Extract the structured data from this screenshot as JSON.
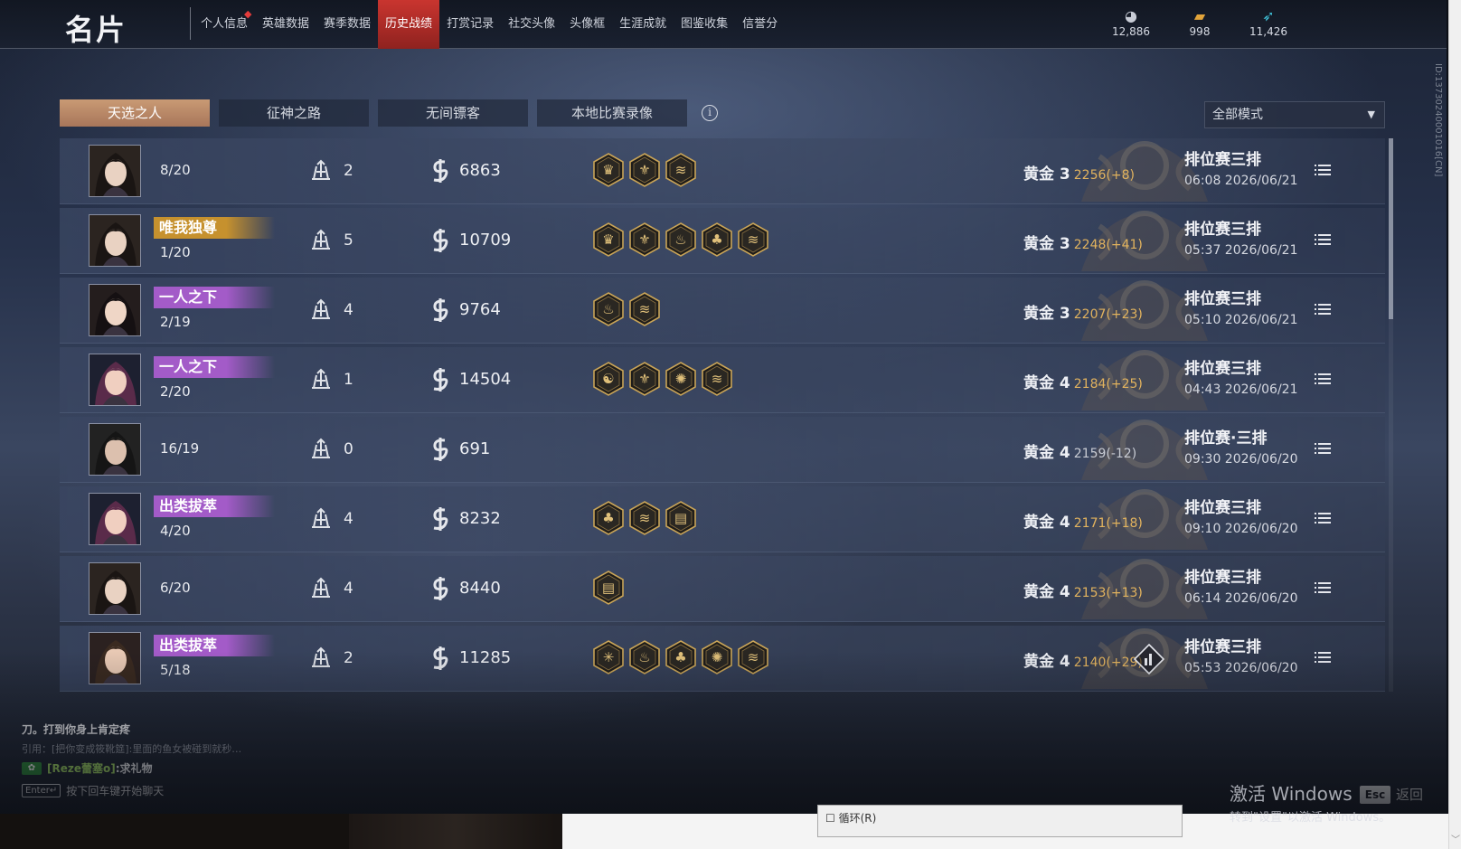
{
  "header": {
    "title": "名片",
    "tabs": [
      {
        "label": "个人信息",
        "active": false,
        "badge": true
      },
      {
        "label": "英雄数据",
        "active": false
      },
      {
        "label": "赛季数据",
        "active": false
      },
      {
        "label": "历史战绩",
        "active": true
      },
      {
        "label": "打赏记录",
        "active": false
      },
      {
        "label": "社交头像",
        "active": false
      },
      {
        "label": "头像框",
        "active": false
      },
      {
        "label": "生涯成就",
        "active": false
      },
      {
        "label": "图鉴收集",
        "active": false
      },
      {
        "label": "信誉分",
        "active": false
      }
    ],
    "currencies": [
      {
        "icon": "coin-stack-icon",
        "value": "12,886"
      },
      {
        "icon": "gold-bar-icon",
        "value": "998"
      },
      {
        "icon": "feather-icon",
        "value": "11,426"
      }
    ],
    "vertical_id": "ID:13730240001016[CN]"
  },
  "modes": {
    "tabs": [
      {
        "label": "天选之人",
        "active": true
      },
      {
        "label": "征神之路",
        "active": false
      },
      {
        "label": "无间镖客",
        "active": false
      },
      {
        "label": "本地比赛录像",
        "active": false
      }
    ],
    "info_icon": "info-icon",
    "filter_label": "全部模式"
  },
  "matches": [
    {
      "avatar": "hero-1",
      "title": "",
      "title_color": "",
      "placement": "8/20",
      "kills": "2",
      "damage": "6863",
      "medals": [
        "crown-medal",
        "helm-medal",
        "wing-medal"
      ],
      "rank": "黄金 3",
      "points": "2256(+8)",
      "trend": "up",
      "queue": "排位赛三排",
      "time": "06:08  2026/06/21",
      "stats_button": false
    },
    {
      "avatar": "hero-1",
      "title": "唯我独尊",
      "title_color": "#c6912e",
      "placement": "1/20",
      "kills": "5",
      "damage": "10709",
      "medals": [
        "crown-medal",
        "helm-medal",
        "flame-medal",
        "trio-medal",
        "wing-medal"
      ],
      "rank": "黄金 3",
      "points": "2248(+41)",
      "trend": "up",
      "queue": "排位赛三排",
      "time": "05:37  2026/06/21",
      "stats_button": false
    },
    {
      "avatar": "hero-2",
      "title": "一人之下",
      "title_color": "#a35bc8",
      "placement": "2/19",
      "kills": "4",
      "damage": "9764",
      "medals": [
        "flame-medal",
        "wing-medal"
      ],
      "rank": "黄金 3",
      "points": "2207(+23)",
      "trend": "up",
      "queue": "排位赛三排",
      "time": "05:10  2026/06/21",
      "stats_button": false
    },
    {
      "avatar": "hero-3",
      "title": "一人之下",
      "title_color": "#a35bc8",
      "placement": "2/20",
      "kills": "1",
      "damage": "14504",
      "medals": [
        "swirl-medal",
        "helm-medal",
        "sun-medal",
        "wing-medal"
      ],
      "rank": "黄金 4",
      "points": "2184(+25)",
      "trend": "up",
      "queue": "排位赛三排",
      "time": "04:43  2026/06/21",
      "stats_button": false
    },
    {
      "avatar": "hero-4",
      "title": "",
      "title_color": "",
      "placement": "16/19",
      "kills": "0",
      "damage": "691",
      "medals": [],
      "rank": "黄金 4",
      "points": "2159(-12)",
      "trend": "down",
      "queue": "排位赛·三排",
      "time": "09:30  2026/06/20",
      "stats_button": false
    },
    {
      "avatar": "hero-3",
      "title": "出类拔萃",
      "title_color": "#a35bc8",
      "placement": "4/20",
      "kills": "4",
      "damage": "8232",
      "medals": [
        "trio-medal",
        "wing-medal",
        "scroll-medal"
      ],
      "rank": "黄金 4",
      "points": "2171(+18)",
      "trend": "up",
      "queue": "排位赛三排",
      "time": "09:10  2026/06/20",
      "stats_button": false
    },
    {
      "avatar": "hero-1",
      "title": "",
      "title_color": "",
      "placement": "6/20",
      "kills": "4",
      "damage": "8440",
      "medals": [
        "scroll-medal"
      ],
      "rank": "黄金 4",
      "points": "2153(+13)",
      "trend": "up",
      "queue": "排位赛三排",
      "time": "06:14  2026/06/20",
      "stats_button": false
    },
    {
      "avatar": "hero-5",
      "title": "出类拔萃",
      "title_color": "#a35bc8",
      "placement": "5/18",
      "kills": "2",
      "damage": "11285",
      "medals": [
        "star-medal",
        "flame-medal",
        "trio-medal",
        "sun-medal",
        "wing-medal"
      ],
      "rank": "黄金 4",
      "points": "2140(+29)",
      "trend": "up",
      "queue": "排位赛三排",
      "time": "05:53  2026/06/20",
      "stats_button": true
    }
  ],
  "chat": {
    "line1": "刀。打到你身上肯定疼",
    "line2": "引用：[把你变成筱靴筵]:里面的鱼女被碰到就秒…",
    "gift_name": "[Reze蕾塞o]",
    "gift_text": ":求礼物",
    "enter_key": "Enter↵",
    "hint": "按下回车键开始聊天"
  },
  "footer": {
    "esc_key": "Esc",
    "back_label": "返回",
    "activate_title": "激活 Windows",
    "activate_sub": "转到\"设置\"以激活 Windows。",
    "dialog_text": "☐ 循环(R)"
  }
}
